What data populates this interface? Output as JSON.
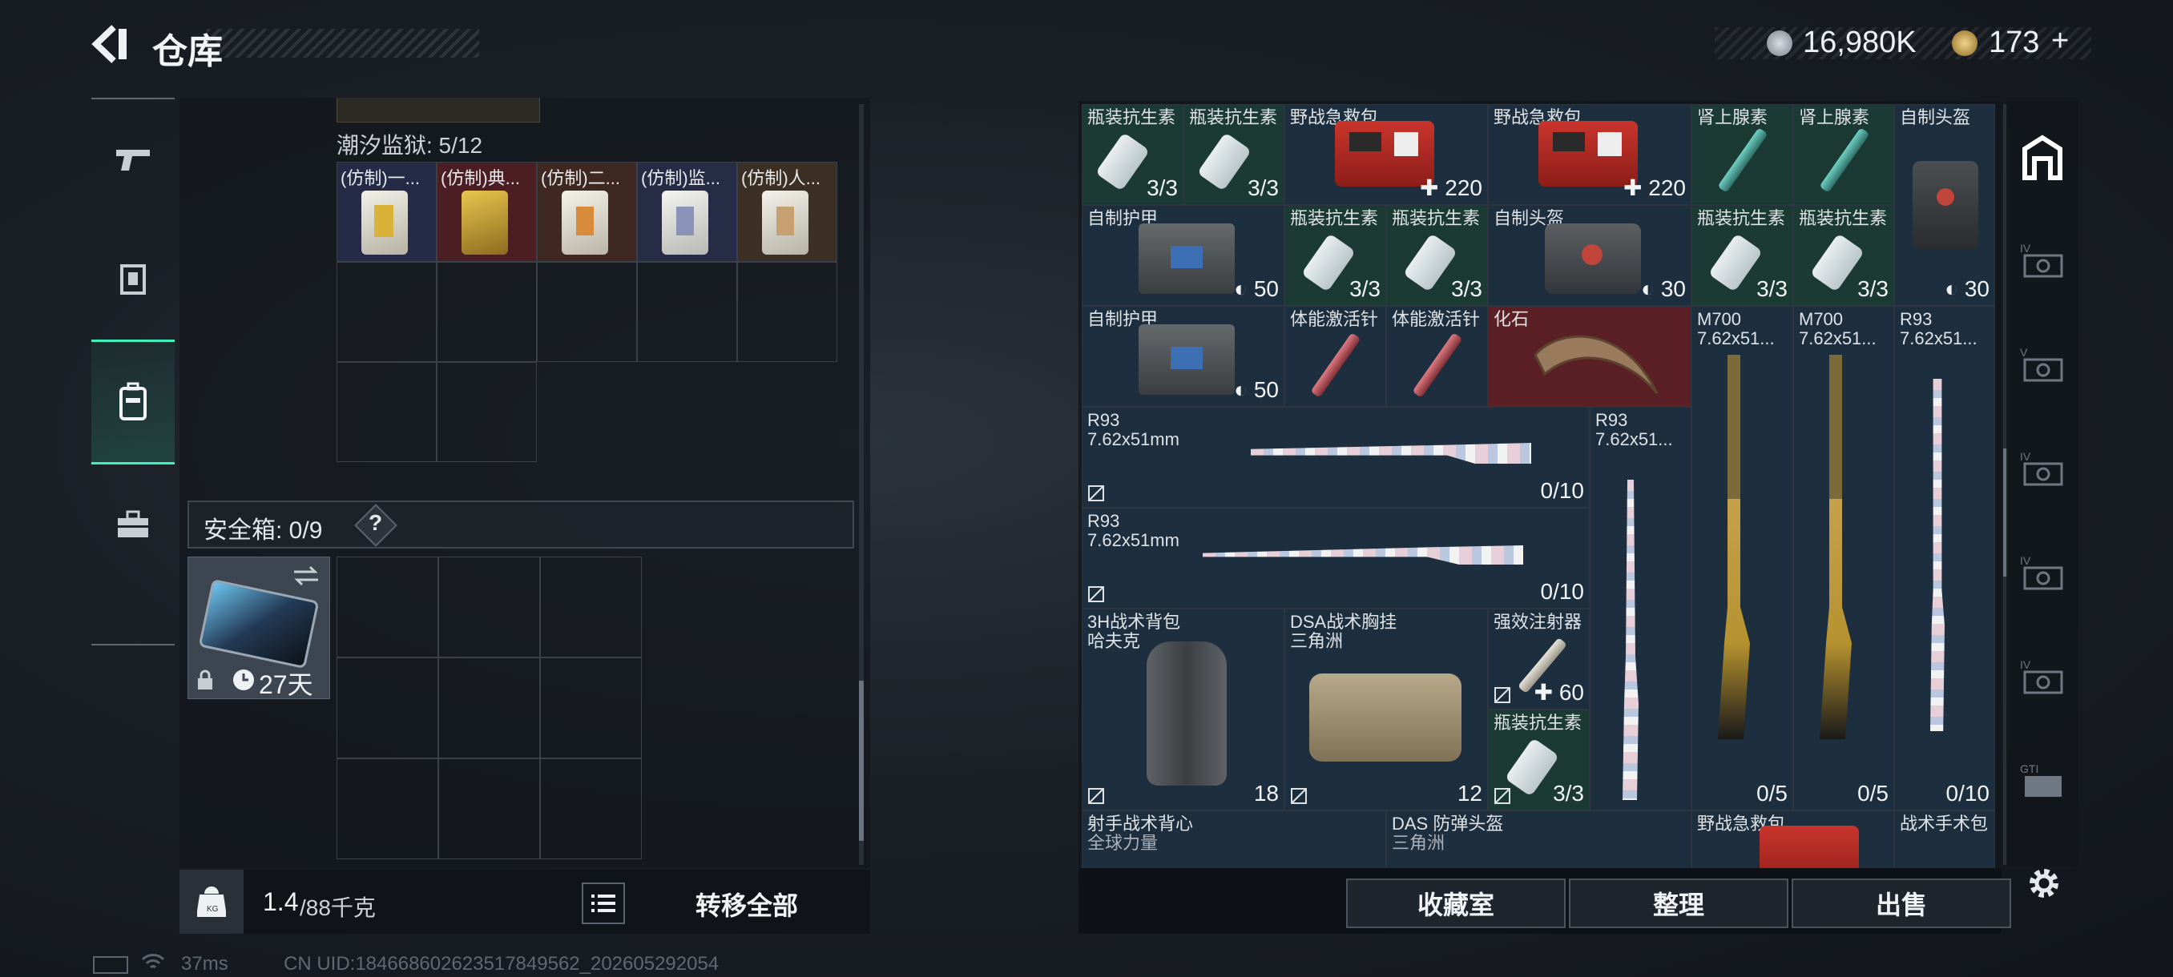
{
  "header": {
    "title": "仓库",
    "currency_silver": "16,980K",
    "currency_gold": "173",
    "plus": "+"
  },
  "colors": {
    "accent": "#3df1bd",
    "green_item": "#1b3a33",
    "red_item": "#5a2025",
    "blue_item": "#1d2e3f"
  },
  "nav": {
    "items": [
      "gun-icon",
      "armor-icon",
      "backpack-icon",
      "toolbox-icon"
    ],
    "selected": 2
  },
  "left": {
    "container_title": "潮汐监狱: 5/12",
    "container_items": [
      "(仿制)一...",
      "(仿制)典...",
      "(仿制)二...",
      "(仿制)监...",
      "(仿制)人..."
    ],
    "safe_box_label": "安全箱: 0/9",
    "safe_box_help": "?",
    "safe_box_time": "27天",
    "weight_value": "1.4",
    "weight_unit": "/88千克",
    "transfer_all": "转移全部"
  },
  "right": {
    "items": [
      {
        "name": "瓶装抗生素",
        "count": "3/3"
      },
      {
        "name": "瓶装抗生素",
        "count": "3/3"
      },
      {
        "name": "野战急救包",
        "count": "220"
      },
      {
        "name": "野战急救包",
        "count": "220"
      },
      {
        "name": "肾上腺素",
        "count": ""
      },
      {
        "name": "肾上腺素",
        "count": ""
      },
      {
        "name": "自制头盔",
        "count": ""
      },
      {
        "name": "自制护甲",
        "count": "50"
      },
      {
        "name": "瓶装抗生素",
        "count": "3/3"
      },
      {
        "name": "瓶装抗生素",
        "count": "3/3"
      },
      {
        "name": "自制头盔",
        "count": "30"
      },
      {
        "name": "瓶装抗生素",
        "count": "3/3"
      },
      {
        "name": "瓶装抗生素",
        "count": "3/3"
      },
      {
        "name": "",
        "count": "30"
      },
      {
        "name": "自制护甲",
        "count": "50"
      },
      {
        "name": "体能激活针",
        "count": ""
      },
      {
        "name": "体能激活针",
        "count": ""
      },
      {
        "name": "化石",
        "count": ""
      },
      {
        "name": "M700",
        "sub": "7.62x51...",
        "count": "0/5"
      },
      {
        "name": "M700",
        "sub": "7.62x51...",
        "count": "0/5"
      },
      {
        "name": "R93",
        "sub": "7.62x51...",
        "count": "0/10"
      },
      {
        "name": "R93",
        "sub": "7.62x51mm",
        "count": "0/10"
      },
      {
        "name": "R93",
        "sub": "7.62x51...",
        "count": ""
      },
      {
        "name": "R93",
        "sub": "7.62x51mm",
        "count": "0/10"
      },
      {
        "name": "3H战术背包",
        "sub": "哈夫克",
        "count": "18"
      },
      {
        "name": "DSA战术胸挂",
        "sub": "三角洲",
        "count": "12"
      },
      {
        "name": "强效注射器",
        "count": "60"
      },
      {
        "name": "瓶装抗生素",
        "count": "3/3"
      },
      {
        "name": "射手战术背心",
        "sub": "全球力量",
        "count": ""
      },
      {
        "name": "DAS 防弹头盔",
        "sub": "三角洲",
        "count": ""
      },
      {
        "name": "野战急救包",
        "count": ""
      },
      {
        "name": "战术手术包",
        "count": ""
      }
    ],
    "buttons": [
      "收藏室",
      "整理",
      "出售"
    ]
  },
  "side_icons": [
    "storage-tab-icon",
    "shelf-iv-icon",
    "shelf-v-icon",
    "shelf-iv-icon",
    "shelf-iv-icon",
    "shelf-iv-icon",
    "shelf-gti-icon"
  ],
  "status": {
    "ping": "37ms",
    "uid": "CN UID:18466860262351784​9562_202605292054"
  }
}
